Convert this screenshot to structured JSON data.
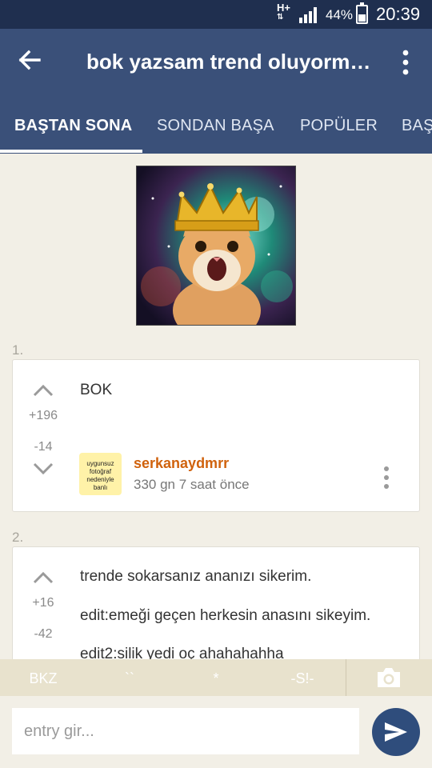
{
  "status_bar": {
    "network_type": "H+",
    "battery_percent": "44%",
    "battery_level": 0.44,
    "time": "20:39"
  },
  "toolbar": {
    "back_icon": "arrow-left-icon",
    "title": "bok yazsam trend oluyormu...",
    "menu_icon": "more-vertical-icon"
  },
  "tabs": [
    {
      "label": "BAŞTAN SONA",
      "active": true
    },
    {
      "label": "SONDAN BAŞA"
    },
    {
      "label": "POPÜLER"
    },
    {
      "label": "BAŞ"
    }
  ],
  "colors": {
    "status_bar": "#1f2f4f",
    "toolbar": "#3a5079",
    "author": "#d0620d",
    "background": "#f2efe6",
    "send_button": "#2f4d7c"
  },
  "entries": [
    {
      "number": "1.",
      "upvotes": "+196",
      "downvotes": "-14",
      "text": [
        "BOK"
      ],
      "avatar_text": "uygunsuz fotoğraf nedeniyle banlı",
      "author": "serkanaydmrr",
      "time": "330 gn 7 saat  önce"
    },
    {
      "number": "2.",
      "upvotes": "+16",
      "downvotes": "-42",
      "text": [
        "trende sokarsanız ananızı sikerim.",
        "edit:emeği geçen herkesin anasını sikeyim.",
        "edit2:silik yedi oç ahahahahha"
      ]
    }
  ],
  "format_bar": {
    "buttons": [
      "BKZ",
      "``",
      "*",
      "-S!-"
    ],
    "camera_icon": "camera-icon"
  },
  "composer": {
    "placeholder": "entry gir...",
    "send_icon": "send-icon"
  }
}
